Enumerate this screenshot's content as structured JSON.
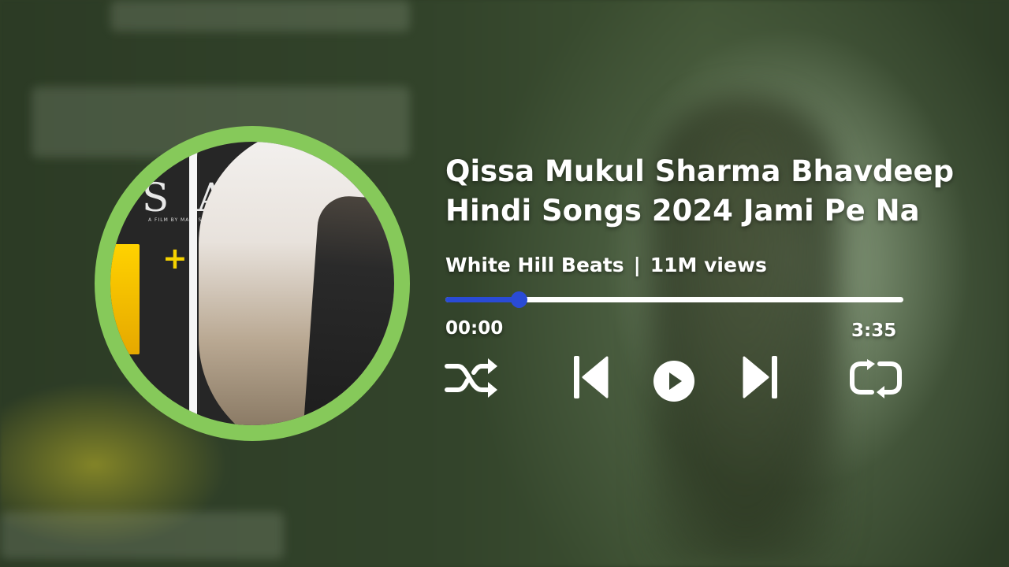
{
  "track": {
    "title": "Qissa Mukul Sharma Bhavdeep\nHindi Songs 2024 Jami Pe Na",
    "channel": "White Hill Beats",
    "separator": "|",
    "views": "11M views"
  },
  "cover": {
    "title_text": "S A",
    "subtitle_text": "A FILM BY MANI SHERGILL",
    "plus_text": "+"
  },
  "progress": {
    "current_time": "00:00",
    "total_time": "3:35",
    "fraction": 0.16
  },
  "controls": {
    "shuffle_icon": "shuffle-icon",
    "prev_icon": "skip-previous-icon",
    "play_icon": "play-circle-icon",
    "next_icon": "skip-next-icon",
    "repeat_icon": "repeat-icon"
  },
  "colors": {
    "accent": "#2a4bd6",
    "disc_ring": "#86c95a",
    "text": "#ffffff"
  }
}
